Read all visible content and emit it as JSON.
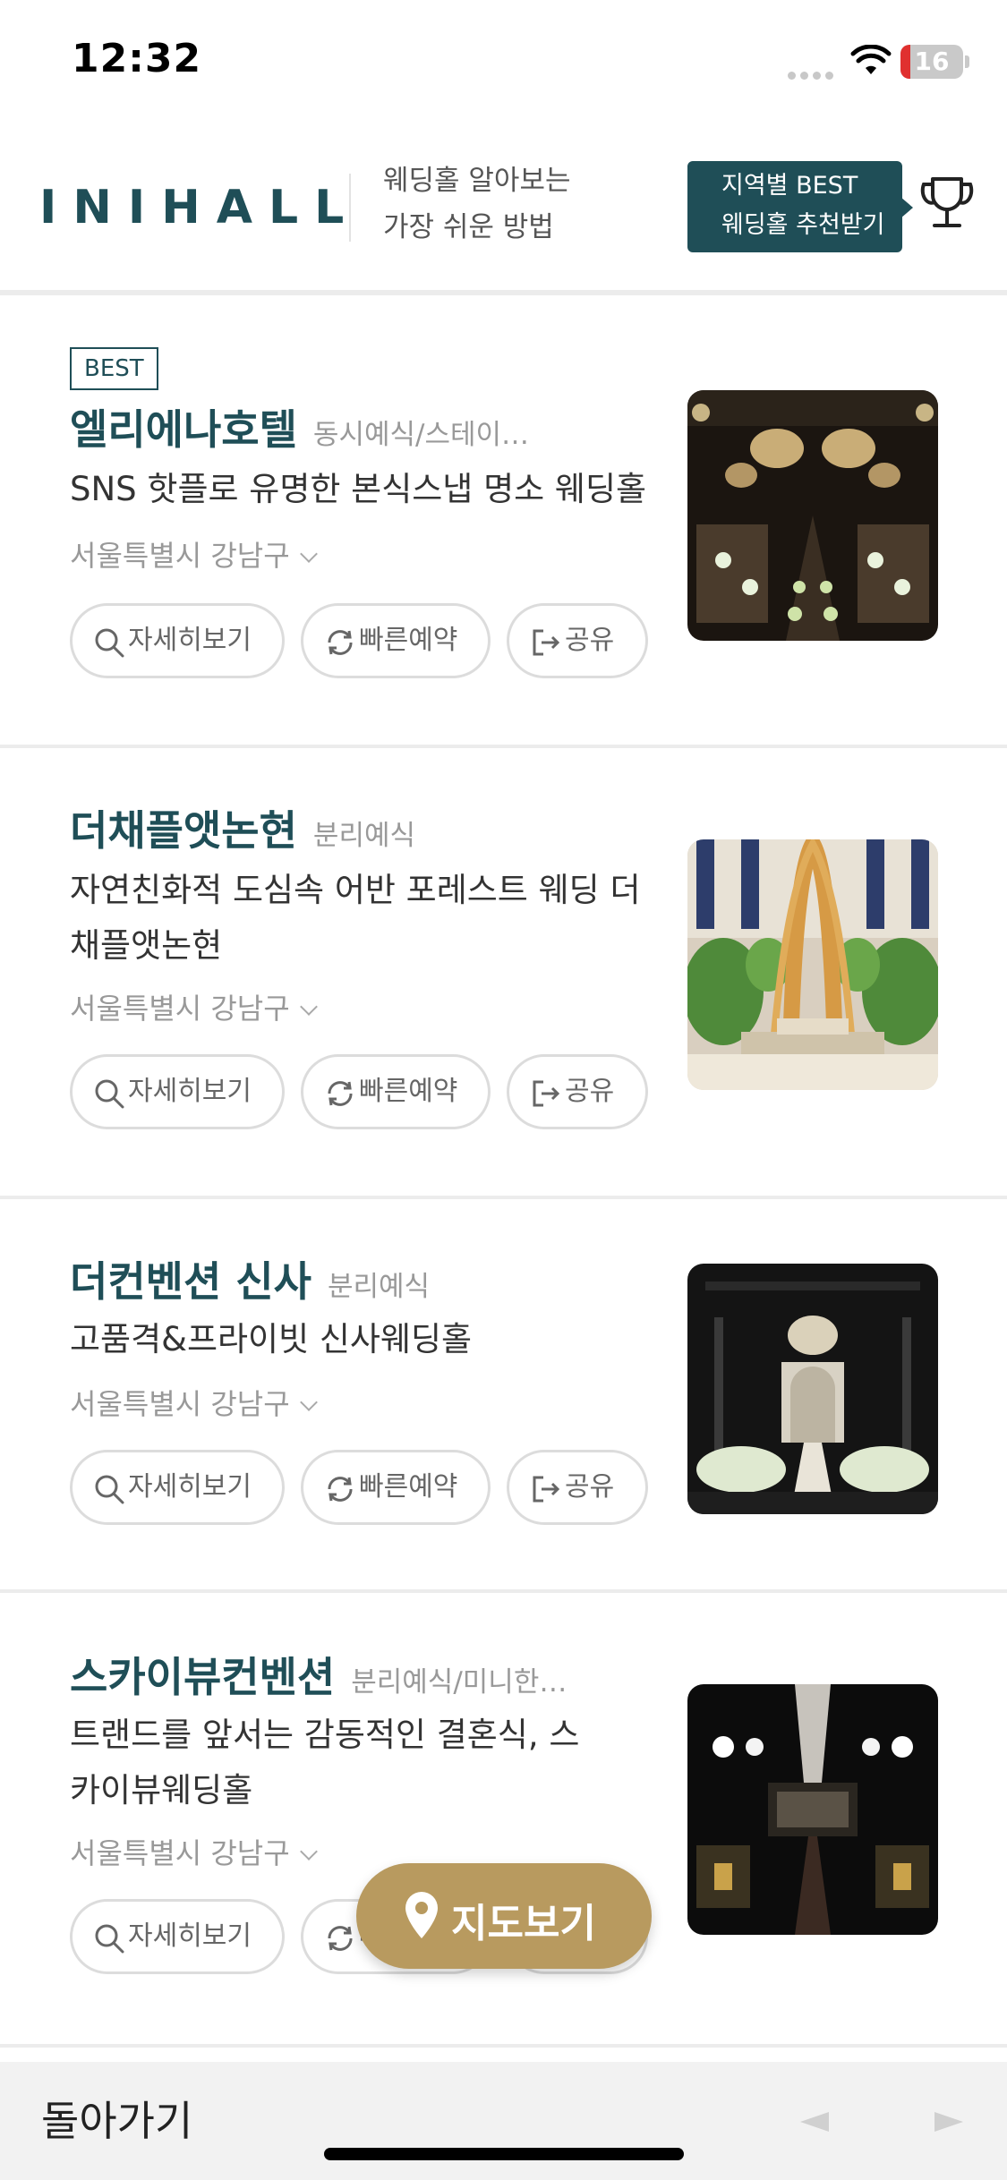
{
  "status_bar": {
    "time": "12:32",
    "battery_level": "16",
    "battery_fraction": 0.16,
    "battery_color": "#e0302f"
  },
  "header": {
    "logo": "INIHALL",
    "tagline_line1": "웨딩홀 알아보는",
    "tagline_line2": "가장 쉬운 방법",
    "best_button_line1": "지역별 BEST",
    "best_button_line2": "웨딩홀 추천받기",
    "trophy_icon": "trophy-icon",
    "accent_color": "#1f4e57"
  },
  "actions": {
    "detail_label": "자세히보기",
    "detail_icon": "search-icon",
    "reserve_label": "빠른예약",
    "reserve_icon": "refresh-icon",
    "share_label": "공유",
    "share_icon": "share-icon"
  },
  "venues": [
    {
      "badge": "BEST",
      "name": "엘리에나호텔",
      "type": "동시예식/스테이…",
      "description": "SNS 핫플로 유명한 본식스냅 명소 웨딩홀",
      "region": "서울특별시 강남구"
    },
    {
      "name": "더채플앳논현",
      "type": "분리예식",
      "description": "자연친화적 도심속 어반 포레스트 웨딩 더채플앳논현",
      "region": "서울특별시 강남구"
    },
    {
      "name": "더컨벤션 신사",
      "type": "분리예식",
      "description": "고품격&프라이빗 신사웨딩홀",
      "region": "서울특별시 강남구"
    },
    {
      "name": "스카이뷰컨벤션",
      "type": "분리예식/미니한…",
      "description": "트랜드를 앞서는 감동적인 결혼식, 스카이뷰웨딩홀",
      "region": "서울특별시 강남구"
    }
  ],
  "map_button": {
    "label": "지도보기",
    "icon": "map-pin-icon",
    "color": "#b89a5f"
  },
  "bottom_bar": {
    "back_label": "돌아가기",
    "prev_icon": "arrow-left-icon",
    "next_icon": "arrow-right-icon"
  }
}
